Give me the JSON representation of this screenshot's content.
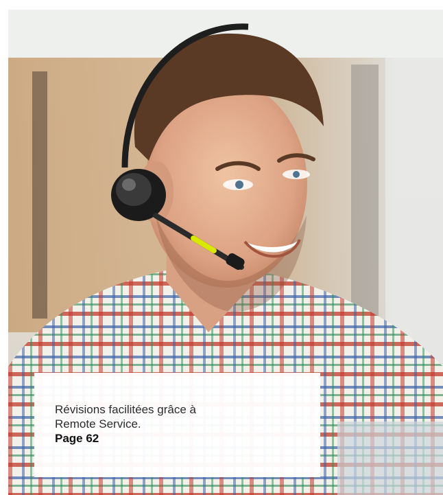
{
  "photo": {
    "subject": "support-agent-with-headset",
    "accent": "#d8e800"
  },
  "caption": {
    "line1": "Révisions facilitées grâce à",
    "line2": "Remote Service.",
    "page_ref": "Page 62"
  }
}
